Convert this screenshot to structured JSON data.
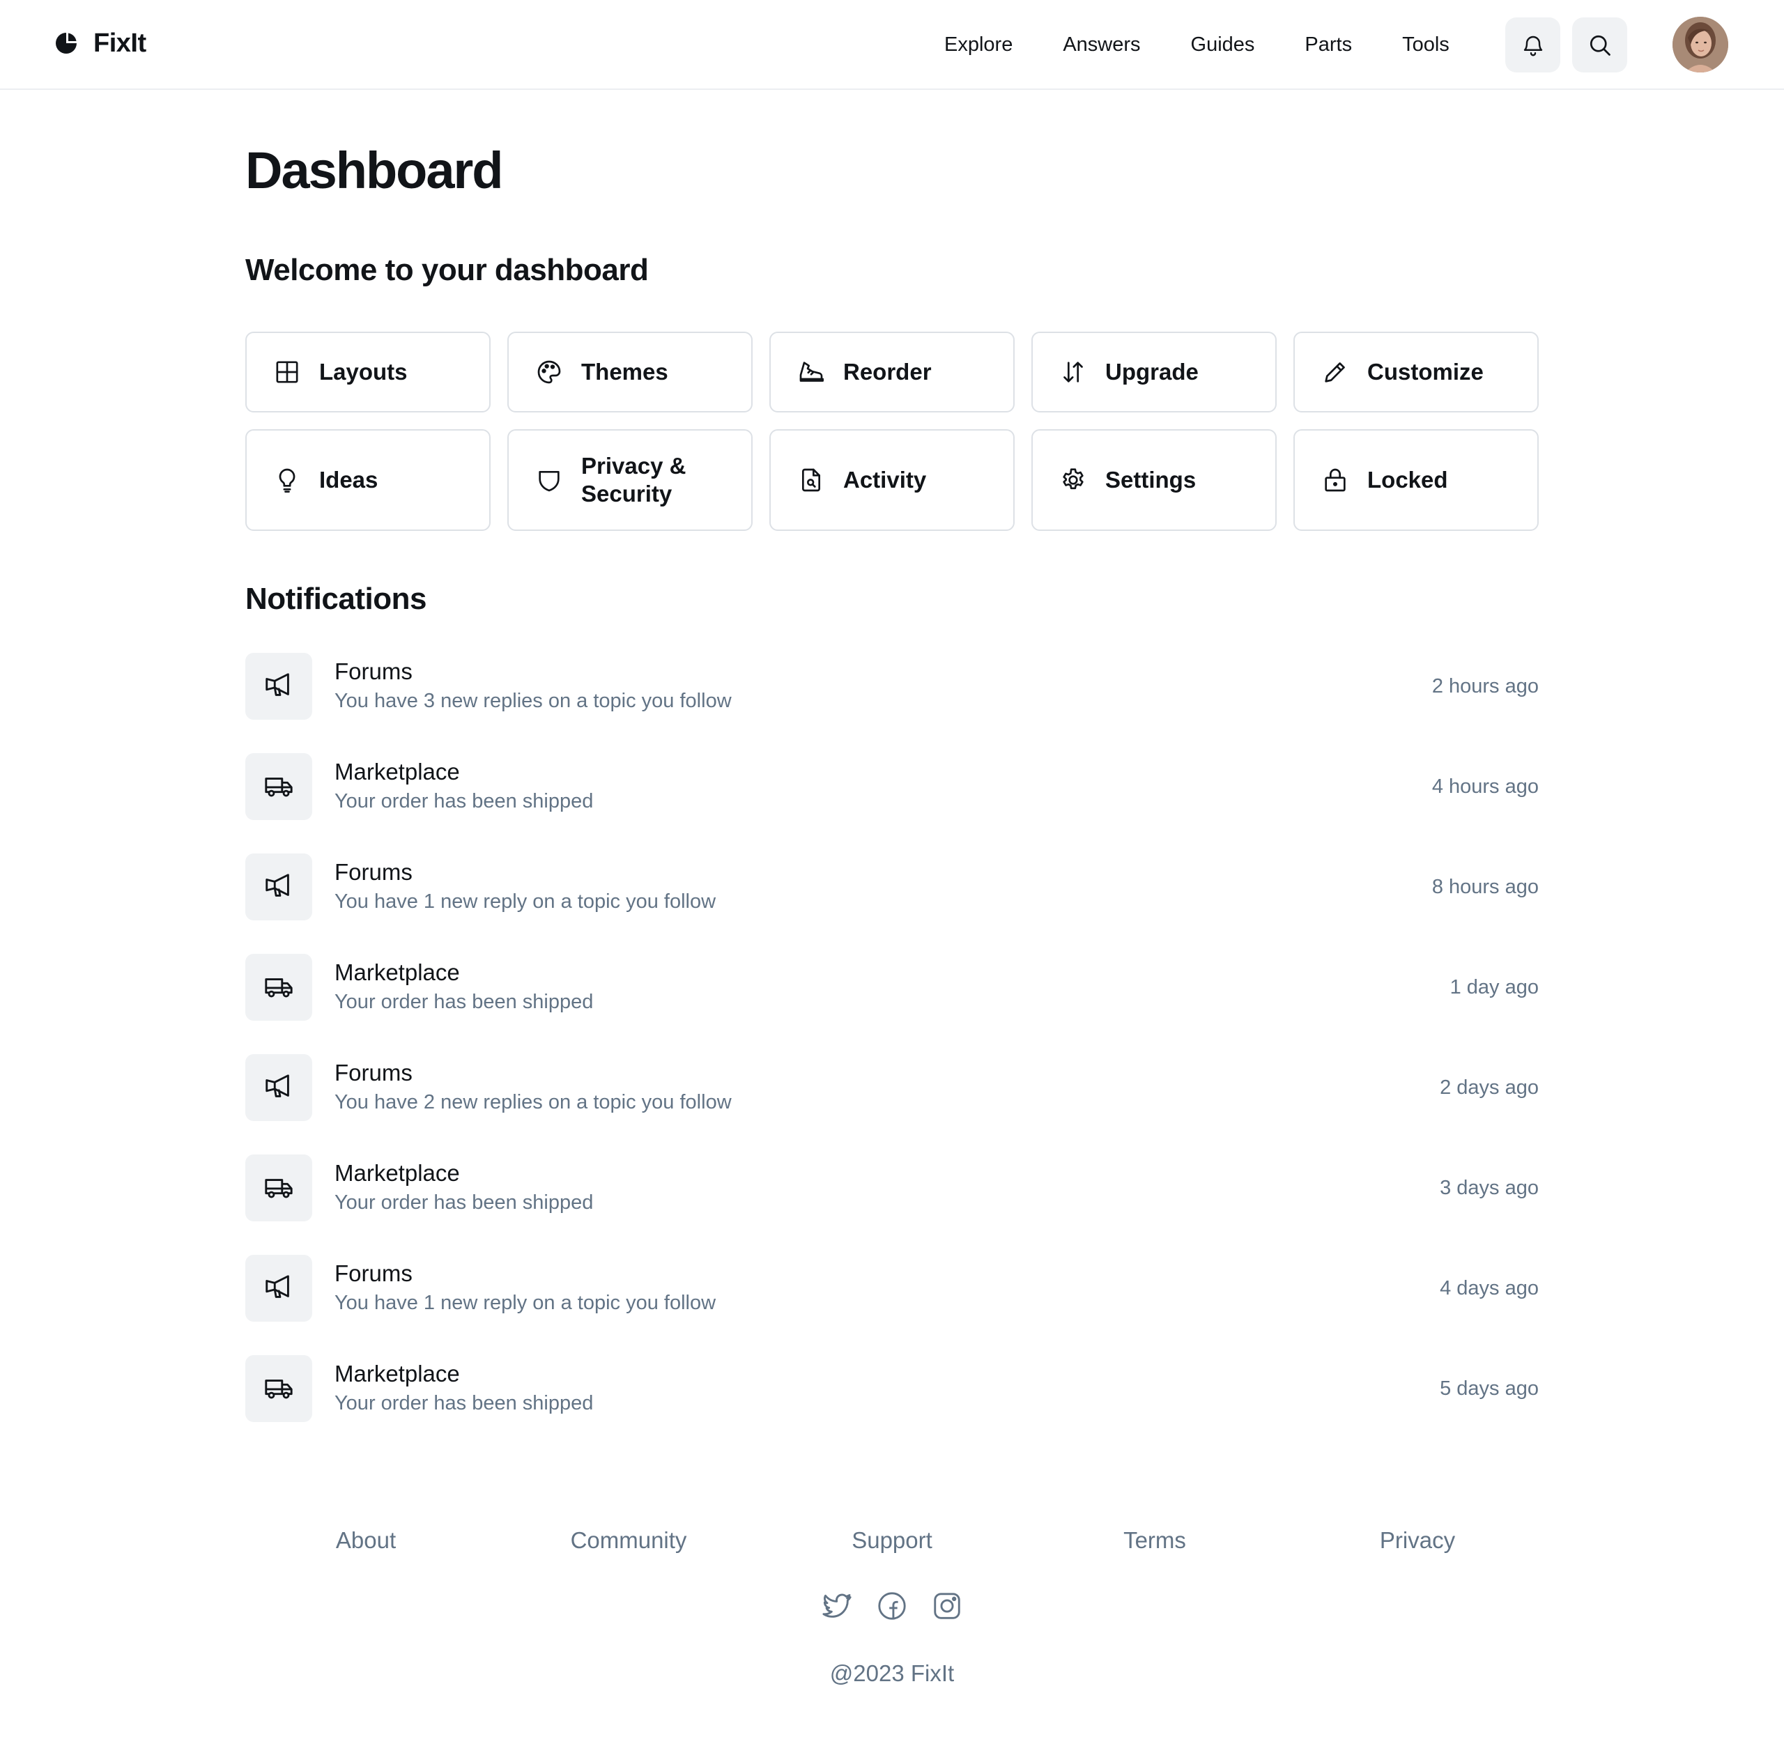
{
  "header": {
    "brand": "FixIt",
    "nav": [
      "Explore",
      "Answers",
      "Guides",
      "Parts",
      "Tools"
    ],
    "notifications_icon": "bell-icon",
    "search_icon": "search-icon"
  },
  "main": {
    "title": "Dashboard",
    "welcome": "Welcome to your dashboard",
    "tiles": [
      {
        "label": "Layouts",
        "icon": "grid-icon"
      },
      {
        "label": "Themes",
        "icon": "palette-icon"
      },
      {
        "label": "Reorder",
        "icon": "shoe-icon"
      },
      {
        "label": "Upgrade",
        "icon": "sort-arrows-icon"
      },
      {
        "label": "Customize",
        "icon": "pencil-icon"
      },
      {
        "label": "Ideas",
        "icon": "lightbulb-icon"
      },
      {
        "label": "Privacy & Security",
        "icon": "shield-icon"
      },
      {
        "label": "Activity",
        "icon": "file-search-icon"
      },
      {
        "label": "Settings",
        "icon": "gear-icon"
      },
      {
        "label": "Locked",
        "icon": "lock-icon"
      }
    ],
    "notifications_title": "Notifications",
    "notifications": [
      {
        "source": "Forums",
        "message": "You have 3 new replies on a topic you follow",
        "time": "2 hours ago",
        "icon": "megaphone-icon"
      },
      {
        "source": "Marketplace",
        "message": "Your order has been shipped",
        "time": "4 hours ago",
        "icon": "truck-icon"
      },
      {
        "source": "Forums",
        "message": "You have 1 new reply on a topic you follow",
        "time": "8 hours ago",
        "icon": "megaphone-icon"
      },
      {
        "source": "Marketplace",
        "message": "Your order has been shipped",
        "time": "1 day ago",
        "icon": "truck-icon"
      },
      {
        "source": "Forums",
        "message": "You have 2 new replies on a topic you follow",
        "time": "2 days ago",
        "icon": "megaphone-icon"
      },
      {
        "source": "Marketplace",
        "message": "Your order has been shipped",
        "time": "3 days ago",
        "icon": "truck-icon"
      },
      {
        "source": "Forums",
        "message": "You have 1 new reply on a topic you follow",
        "time": "4 days ago",
        "icon": "megaphone-icon"
      },
      {
        "source": "Marketplace",
        "message": "Your order has been shipped",
        "time": "5 days ago",
        "icon": "truck-icon"
      }
    ]
  },
  "footer": {
    "links": [
      "About",
      "Community",
      "Support",
      "Terms",
      "Privacy"
    ],
    "socials": [
      "twitter-icon",
      "facebook-icon",
      "instagram-icon"
    ],
    "copyright": "@2023 FixIt"
  },
  "colors": {
    "text": "#111418",
    "muted": "#627385",
    "border": "#dde1e6",
    "icon_bg": "#f0f2f4"
  }
}
